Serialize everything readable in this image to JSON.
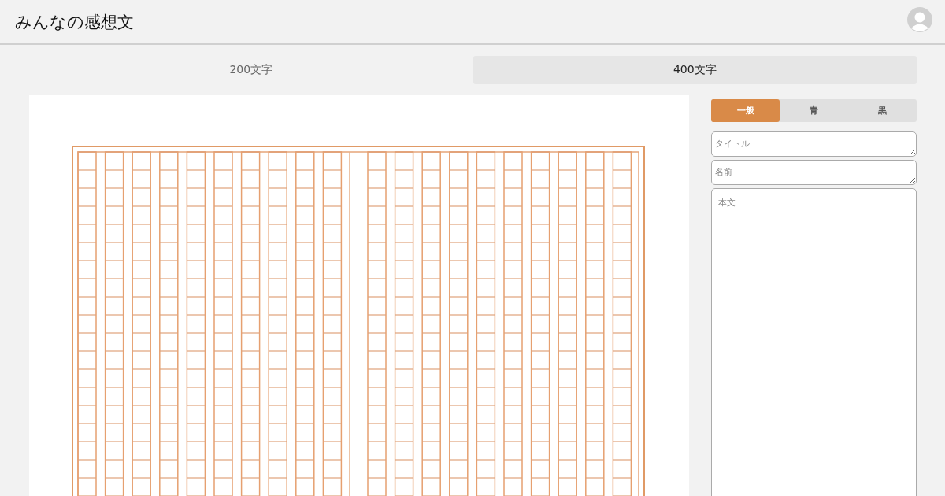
{
  "header": {
    "title": "みんなの感想文"
  },
  "tabs": [
    {
      "label": "200文字",
      "selected": false
    },
    {
      "label": "400文字",
      "selected": true
    }
  ],
  "color_tabs": [
    {
      "label": "一般",
      "selected": true
    },
    {
      "label": "青",
      "selected": false
    },
    {
      "label": "黒",
      "selected": false
    }
  ],
  "fields": [
    {
      "kind": "single",
      "placeholder": "タイトル"
    },
    {
      "kind": "single",
      "placeholder": "名前"
    },
    {
      "kind": "body",
      "placeholder": "本文"
    }
  ]
}
